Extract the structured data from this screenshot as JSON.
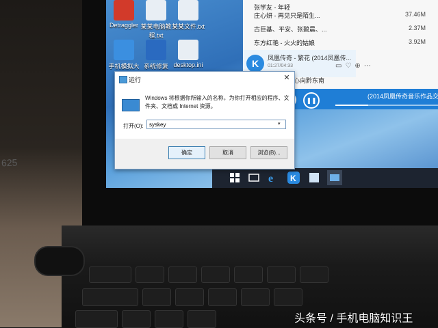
{
  "desktop": {
    "icons": [
      {
        "label": "Detraggler",
        "color": "#d23a2a"
      },
      {
        "label": "某某电脑教程.txt",
        "color": "#e8eef4"
      },
      {
        "label": "某某文件.txt",
        "color": "#e8eef4"
      },
      {
        "label": "手机模拟大师",
        "color": "#3b8fe0"
      },
      {
        "label": "系统修复",
        "color": "#2a6ac0"
      },
      {
        "label": "desktop.ini",
        "color": "#e8eef4"
      }
    ]
  },
  "player": {
    "songs": [
      {
        "title": "张学友 - 年轻",
        "size": ""
      },
      {
        "title": "庄心妍 - 再见只是陌生...",
        "size": "37.46M"
      },
      {
        "title": "古巨基、平安、张碧晨、...",
        "size": "2.37M"
      },
      {
        "title": "东方红艳 - 火火的姑娘",
        "size": "3.92M"
      }
    ],
    "now_playing": {
      "title": "凤凰传奇 - 繁花 (2014凤凰传...",
      "time": "01:27/04:33",
      "next": "凤凰传奇 - 心向黔东南"
    },
    "lyric": "(2014凤凰传奇音乐作品交",
    "progress": 0.32,
    "accent": "#1f7ed6"
  },
  "run_dialog": {
    "title": "运行",
    "description": "Windows 将根据你所输入的名称，为你打开相应的程序、文件夹、文档或 Internet 资源。",
    "open_label": "打开(O):",
    "input_value": "syskey",
    "ok": "确定",
    "cancel": "取消",
    "browse": "浏览(B)..."
  },
  "laptop": {
    "model_text": "625"
  },
  "watermark": "头条号 / 手机电脑知识王"
}
